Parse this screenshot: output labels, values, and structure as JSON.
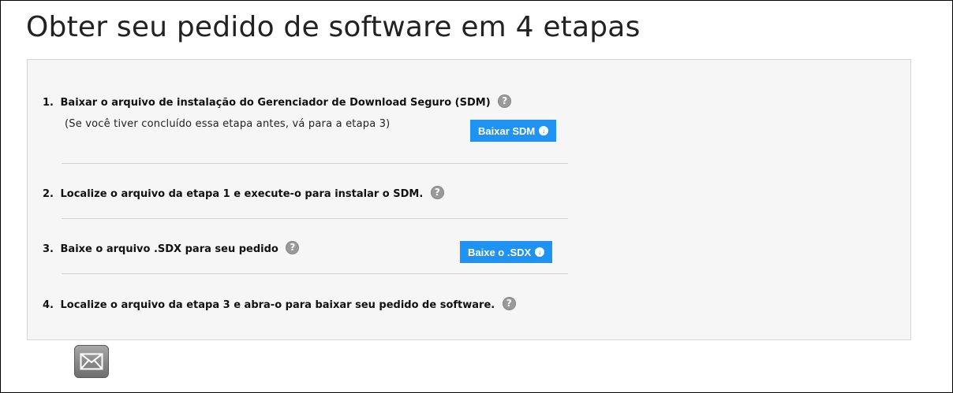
{
  "page": {
    "title": "Obter seu pedido de software em 4 etapas"
  },
  "steps": [
    {
      "number": "1.",
      "text": "Baixar o arquivo de instalação do Gerenciador de Download Seguro (SDM)",
      "note": "(Se você tiver concluído essa etapa antes, vá para a etapa 3)",
      "button_label": "Baixar SDM"
    },
    {
      "number": "2.",
      "text": "Localize o arquivo da etapa 1 e execute-o para instalar o SDM."
    },
    {
      "number": "3.",
      "text": "Baixe o arquivo .SDX para seu pedido",
      "button_label": "Baixe o .SDX"
    },
    {
      "number": "4.",
      "text": "Localize o arquivo da etapa 3 e abra-o para baixar seu pedido de software."
    }
  ],
  "icons": {
    "help": "help-icon",
    "info": "info-icon",
    "mail": "envelope-icon"
  },
  "colors": {
    "button": "#1f93f3",
    "panel": "#f6f6f6"
  }
}
